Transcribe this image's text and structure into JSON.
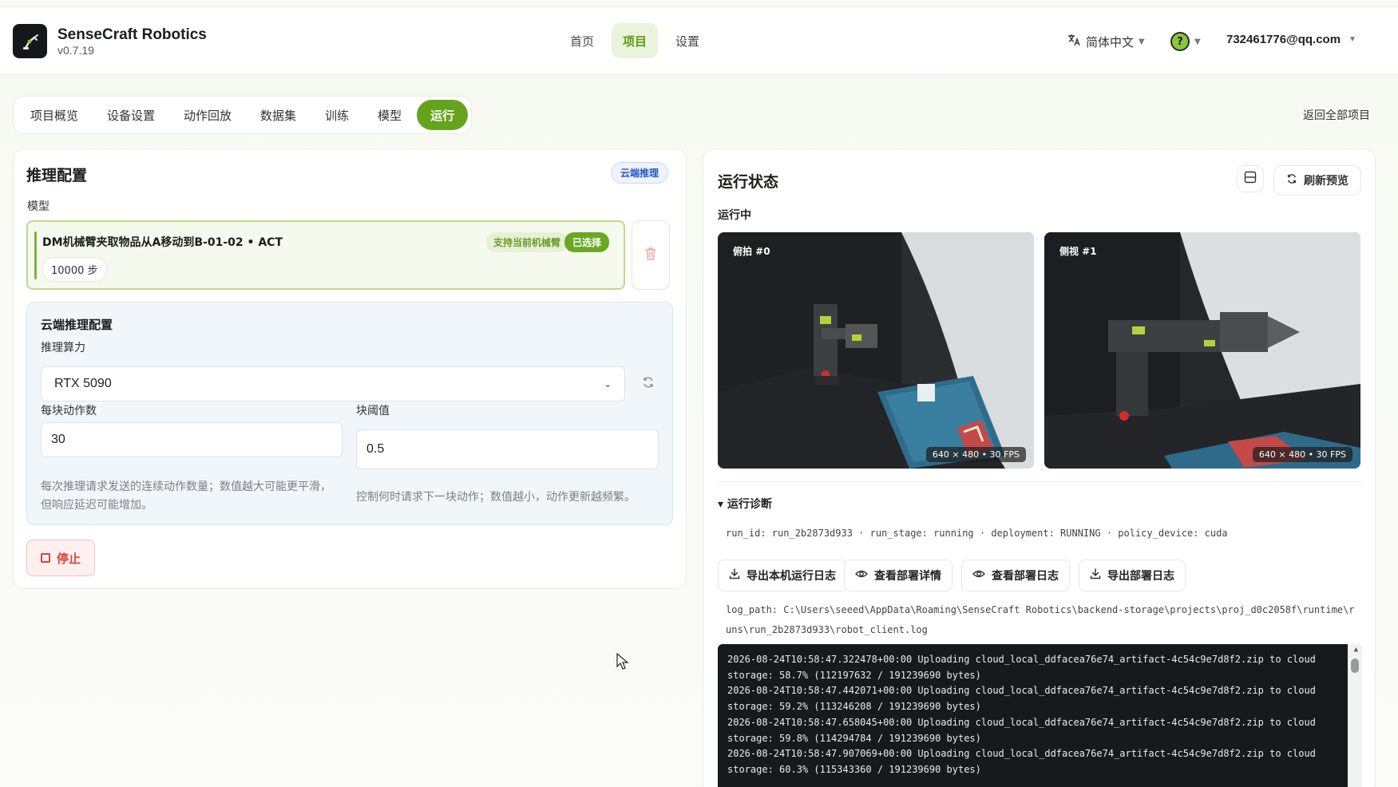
{
  "app": {
    "name": "SenseCraft Robotics",
    "version": "v0.7.19",
    "logo_icon": "robot-arm-logo"
  },
  "topnav": {
    "items": [
      {
        "label": "首页",
        "active": false
      },
      {
        "label": "项目",
        "active": true
      },
      {
        "label": "设置",
        "active": false
      }
    ],
    "language": "简体中文",
    "help_icon": "help-circle-icon",
    "user_email": "732461776@qq.com"
  },
  "tabs": [
    {
      "label": "项目概览",
      "active": false
    },
    {
      "label": "设备设置",
      "active": false
    },
    {
      "label": "动作回放",
      "active": false
    },
    {
      "label": "数据集",
      "active": false
    },
    {
      "label": "训练",
      "active": false
    },
    {
      "label": "模型",
      "active": false
    },
    {
      "label": "运行",
      "active": true
    }
  ],
  "back_link": "返回全部项目",
  "inference": {
    "title": "推理配置",
    "mode_badge": "云端推理",
    "model_label": "模型",
    "model": {
      "name": "DM机械臂夹取物品从A移动到B-01-02 • ACT",
      "steps": "10000 步",
      "support_tag": "支持当前机械臂",
      "selected_tag": "已选择"
    },
    "cloud": {
      "title": "云端推理配置",
      "compute_label": "推理算力",
      "compute_value": "RTX 5090",
      "chunk_label": "每块动作数",
      "chunk_value": "30",
      "chunk_hint": "每次推理请求发送的连续动作数量；数值越大可能更平滑，但响应延迟可能增加。",
      "threshold_label": "块阈值",
      "threshold_value": "0.5",
      "threshold_hint": "控制何时请求下一块动作；数值越小，动作更新越频繁。"
    },
    "stop_label": "停止"
  },
  "status": {
    "title": "运行状态",
    "refresh_label": "刷新预览",
    "running_label": "运行中",
    "cameras": [
      {
        "tag": "俯拍 #0",
        "resolution": "640 × 480 • 30 FPS"
      },
      {
        "tag": "侧视 #1",
        "resolution": "640 × 480 • 30 FPS"
      }
    ],
    "diagnostics_title": "▾ 运行诊断",
    "meta": "run_id: run_2b2873d933 · run_stage: running · deployment: RUNNING · policy_device: cuda",
    "actions": [
      {
        "label": "导出本机运行日志",
        "icon": "download-icon"
      },
      {
        "label": "查看部署详情",
        "icon": "eye-icon"
      },
      {
        "label": "查看部署日志",
        "icon": "eye-icon"
      },
      {
        "label": "导出部署日志",
        "icon": "download-icon"
      }
    ],
    "log_path": "log_path: C:\\Users\\seeed\\AppData\\Roaming\\SenseCraft Robotics\\backend-storage\\projects\\proj_d0c2058f\\runtime\\runs\\run_2b2873d933\\robot_client.log",
    "log_lines": [
      "2026-08-24T10:58:47.322478+00:00 Uploading cloud_local_ddfacea76e74_artifact-4c54c9e7d8f2.zip to cloud",
      "storage: 58.7% (112197632 / 191239690 bytes)",
      "2026-08-24T10:58:47.442071+00:00 Uploading cloud_local_ddfacea76e74_artifact-4c54c9e7d8f2.zip to cloud",
      "storage: 59.2% (113246208 / 191239690 bytes)",
      "2026-08-24T10:58:47.658045+00:00 Uploading cloud_local_ddfacea76e74_artifact-4c54c9e7d8f2.zip to cloud",
      "storage: 59.8% (114294784 / 191239690 bytes)",
      "2026-08-24T10:58:47.907069+00:00 Uploading cloud_local_ddfacea76e74_artifact-4c54c9e7d8f2.zip to cloud",
      "storage: 60.3% (115343360 / 191239690 bytes)"
    ]
  },
  "colors": {
    "accent": "#66a31c",
    "danger": "#d9443a",
    "cloud_blue": "#2457c5"
  }
}
